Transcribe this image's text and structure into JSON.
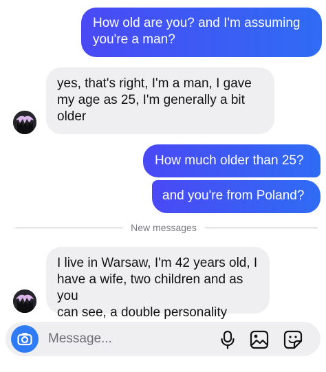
{
  "messages": {
    "m1": "How old are you? and I'm assuming\nyou're a man?",
    "m2": "yes, that's right, I'm a man, I gave\nmy age as 25, I'm generally a bit\nolder",
    "m3": "How much older than 25?",
    "m4": "and you're from Poland?",
    "m5": "I live in Warsaw, I'm 42 years old, I\nhave a wife, two children and as you\ncan see, a double personality"
  },
  "divider": {
    "label": "New messages"
  },
  "composer": {
    "placeholder": "Message..."
  },
  "icons": {
    "camera": "camera-icon",
    "mic": "microphone-icon",
    "gallery": "image-icon",
    "sticker": "sticker-icon"
  },
  "colors": {
    "outgoing_bubble": "#3d5afe",
    "incoming_bubble": "#efeff2",
    "camera_button": "#2f7bf5"
  }
}
